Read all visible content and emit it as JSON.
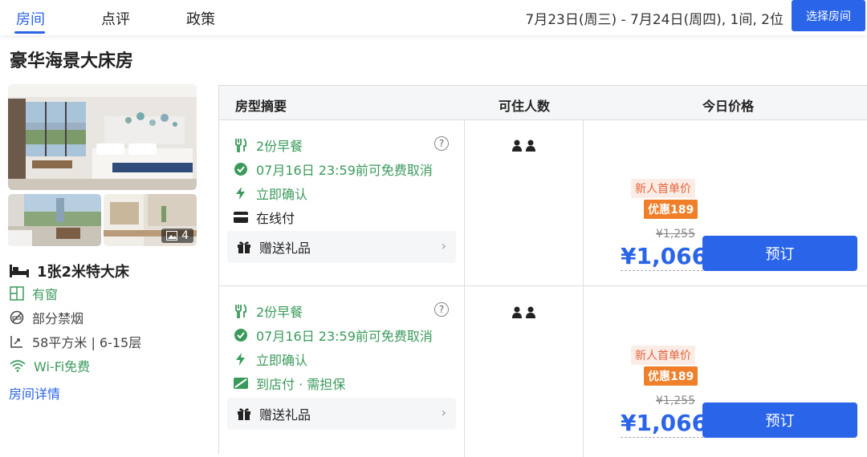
{
  "header": {
    "tabs": [
      {
        "label": "房间",
        "active": true
      },
      {
        "label": "点评",
        "active": false
      },
      {
        "label": "政策",
        "active": false
      }
    ],
    "dates": "7月23日(周三) - 7月24日(周四), 1间, 2位",
    "select_room_button": "选择房间"
  },
  "room": {
    "title": "豪华海景大床房",
    "photo_count": "4",
    "bed": "1张2米特大床",
    "features": [
      {
        "icon": "window-icon",
        "label": "有窗"
      },
      {
        "icon": "no-smoking-icon",
        "label": "部分禁烟"
      },
      {
        "icon": "area-icon",
        "label": "58平方米 | 6-15层"
      },
      {
        "icon": "wifi-icon",
        "label": "Wi-Fi免费"
      }
    ],
    "details_link": "房间详情"
  },
  "table": {
    "headers": [
      "房型摘要",
      "可住人数",
      "今日价格"
    ],
    "rows": [
      {
        "meal": "2份早餐",
        "cancel": "07月16日 23:59前可免费取消",
        "confirm": "立即确认",
        "payment": "在线付",
        "gift": "赠送礼品",
        "new_user_tag": "新人首单价",
        "discount_tag": "优惠189",
        "original_price": "¥1,255",
        "price": "¥1,066",
        "book_label": "预订"
      },
      {
        "meal": "2份早餐",
        "cancel": "07月16日 23:59前可免费取消",
        "confirm": "立即确认",
        "payment": "到店付 · 需担保",
        "gift": "赠送礼品",
        "new_user_tag": "新人首单价",
        "discount_tag": "优惠189",
        "original_price": "¥1,255",
        "price": "¥1,066",
        "book_label": "预订"
      }
    ]
  },
  "colors": {
    "accent": "#2a64e8",
    "green": "#3a9a5b",
    "discount": "#f07f2a",
    "new_user": "#e4653d"
  }
}
